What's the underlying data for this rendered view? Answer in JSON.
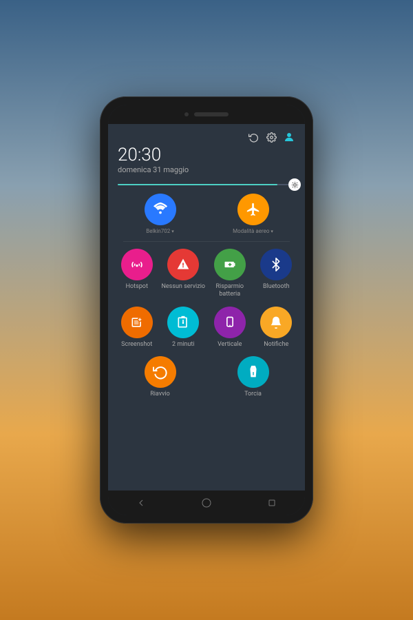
{
  "phone": {
    "time": "20:30",
    "date": "domenica 31 maggio",
    "brightness_pct": 90,
    "wifi_network": "Belkin702",
    "airplane_label": "Modalità aereo",
    "icons": {
      "rotate": "↺",
      "settings": "⚙",
      "account": "👤"
    }
  },
  "toggles": {
    "row1": [
      {
        "id": "wifi",
        "label": "",
        "sublabel": "Belkin702",
        "color": "bg-blue",
        "icon": "wifi"
      },
      {
        "id": "airplane",
        "label": "",
        "sublabel": "Modalità aereo",
        "color": "bg-orange",
        "icon": "airplane"
      }
    ],
    "row2": [
      {
        "id": "hotspot",
        "label": "Hotspot",
        "color": "bg-pink",
        "icon": "hotspot"
      },
      {
        "id": "no-service",
        "label": "Nessun servizio",
        "color": "bg-red",
        "icon": "no-service"
      },
      {
        "id": "battery-saver",
        "label": "Risparmio batteria",
        "color": "bg-green",
        "icon": "battery"
      },
      {
        "id": "bluetooth",
        "label": "Bluetooth",
        "color": "bg-blue-dark",
        "icon": "bluetooth"
      }
    ],
    "row3": [
      {
        "id": "screenshot",
        "label": "Screenshot",
        "color": "bg-orange2",
        "icon": "screenshot"
      },
      {
        "id": "2min",
        "label": "2 minuti",
        "color": "bg-teal",
        "icon": "timer"
      },
      {
        "id": "vertical",
        "label": "Verticale",
        "color": "bg-purple",
        "icon": "rotate"
      },
      {
        "id": "notifiche",
        "label": "Notifiche",
        "color": "bg-yellow",
        "icon": "bell"
      }
    ],
    "row4": [
      {
        "id": "riavvio",
        "label": "Riavvio",
        "color": "bg-orange",
        "icon": "reboot"
      },
      {
        "id": "torcia",
        "label": "Torcia",
        "color": "bg-teal2",
        "icon": "flashlight"
      }
    ]
  },
  "nav": {
    "back_label": "back",
    "home_label": "home",
    "recent_label": "recent"
  }
}
